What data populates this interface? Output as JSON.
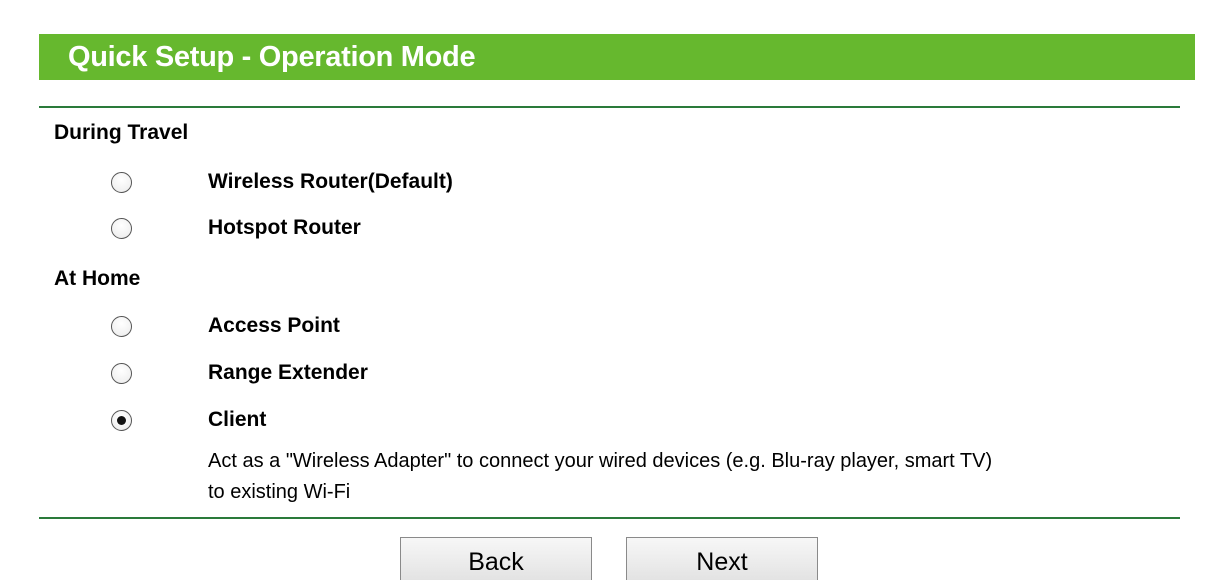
{
  "header": {
    "title": "Quick Setup - Operation Mode"
  },
  "sections": {
    "travel": {
      "label": "During Travel",
      "options": [
        {
          "label": "Wireless Router(Default)",
          "checked": false
        },
        {
          "label": "Hotspot Router",
          "checked": false
        }
      ]
    },
    "home": {
      "label": "At Home",
      "options": [
        {
          "label": "Access Point",
          "checked": false
        },
        {
          "label": "Range Extender",
          "checked": false
        },
        {
          "label": "Client",
          "checked": true
        }
      ]
    }
  },
  "client_description": {
    "line1": "Act as a \"Wireless Adapter\" to connect your wired devices (e.g. Blu-ray player, smart TV)",
    "line2": "to existing Wi-Fi"
  },
  "buttons": {
    "back_label": "Back",
    "next_label": "Next"
  },
  "colors": {
    "header_background": "#66b82e",
    "header_text": "#ffffff",
    "rule": "#2a7a3a"
  },
  "icons": {
    "radio_unchecked": "radio-unchecked-icon",
    "radio_checked": "radio-checked-icon"
  }
}
